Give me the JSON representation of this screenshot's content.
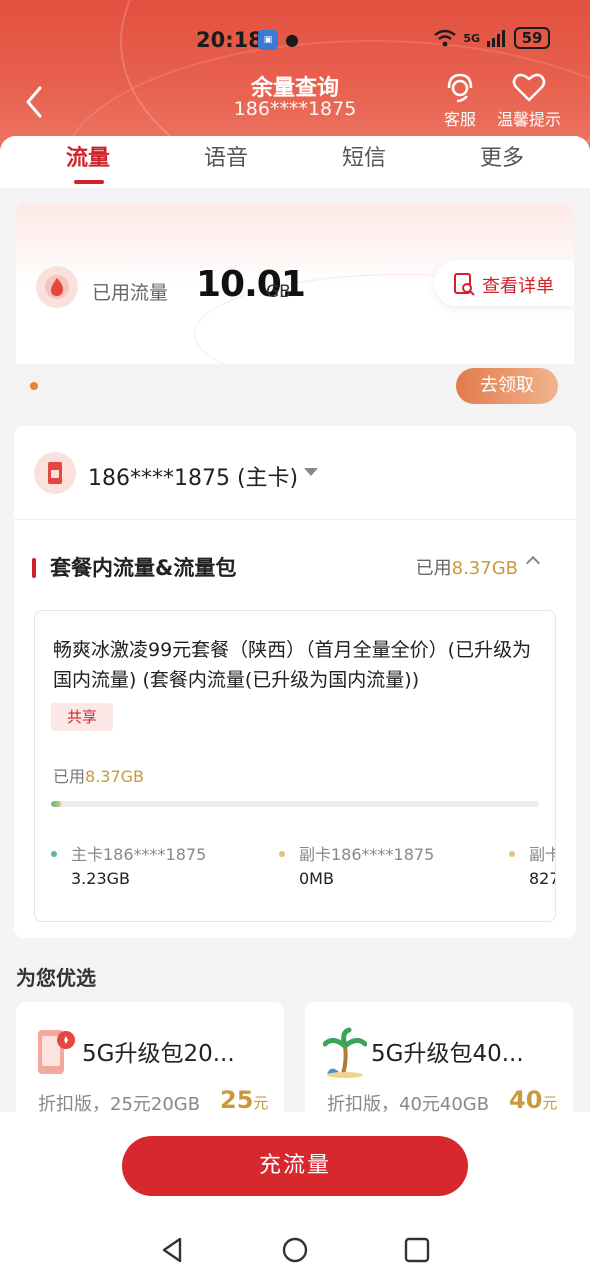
{
  "status_bar": {
    "time": "20:18",
    "network": "5G",
    "battery": "59"
  },
  "header": {
    "title": "余量查询",
    "phone": "186****1875",
    "actions": [
      {
        "label": "客服",
        "icon": "headset-icon"
      },
      {
        "label": "温馨提示",
        "icon": "heart-icon"
      }
    ]
  },
  "tabs": [
    "流量",
    "语音",
    "短信",
    "更多"
  ],
  "usage": {
    "used_label": "已用流量",
    "used_value": "10.01",
    "used_unit": "GB",
    "detail_label": "查看详单",
    "claim_label": "去领取"
  },
  "plan": {
    "phone_select": "186****1875 (主卡)",
    "section_title": "套餐内流量&流量包",
    "section_used_label": "已用",
    "section_used_value": "8.37GB",
    "name": "畅爽冰激凌99元套餐（陕西）（首月全量全价）(已升级为国内流量) (套餐内流量(已升级为国内流量))",
    "badge": "共享",
    "used_label": "已用",
    "used_value": "8.37GB",
    "progress_fraction": 0.02,
    "members": [
      {
        "name": "主卡186****1875",
        "value": "3.23GB",
        "color": "#59b98a"
      },
      {
        "name": "副卡186****1875",
        "value": "0MB",
        "color": "#e0c27a"
      },
      {
        "name": "副卡",
        "value": "827",
        "color": "#e0c27a"
      }
    ]
  },
  "recommend": {
    "title": "为您优选",
    "items": [
      {
        "name": "5G升级包20...",
        "desc": "折扣版，25元20GB",
        "price": "25",
        "unit": "元",
        "icon": "phone-gift-icon"
      },
      {
        "name": "5G升级包40...",
        "desc": "折扣版，40元40GB",
        "price": "40",
        "unit": "元",
        "icon": "palm-tree-icon"
      }
    ]
  },
  "bottom": {
    "recharge_label": "充流量"
  },
  "colors": {
    "brand": "#d2232a",
    "gold": "#c89a3c",
    "header": "#e2513f"
  }
}
